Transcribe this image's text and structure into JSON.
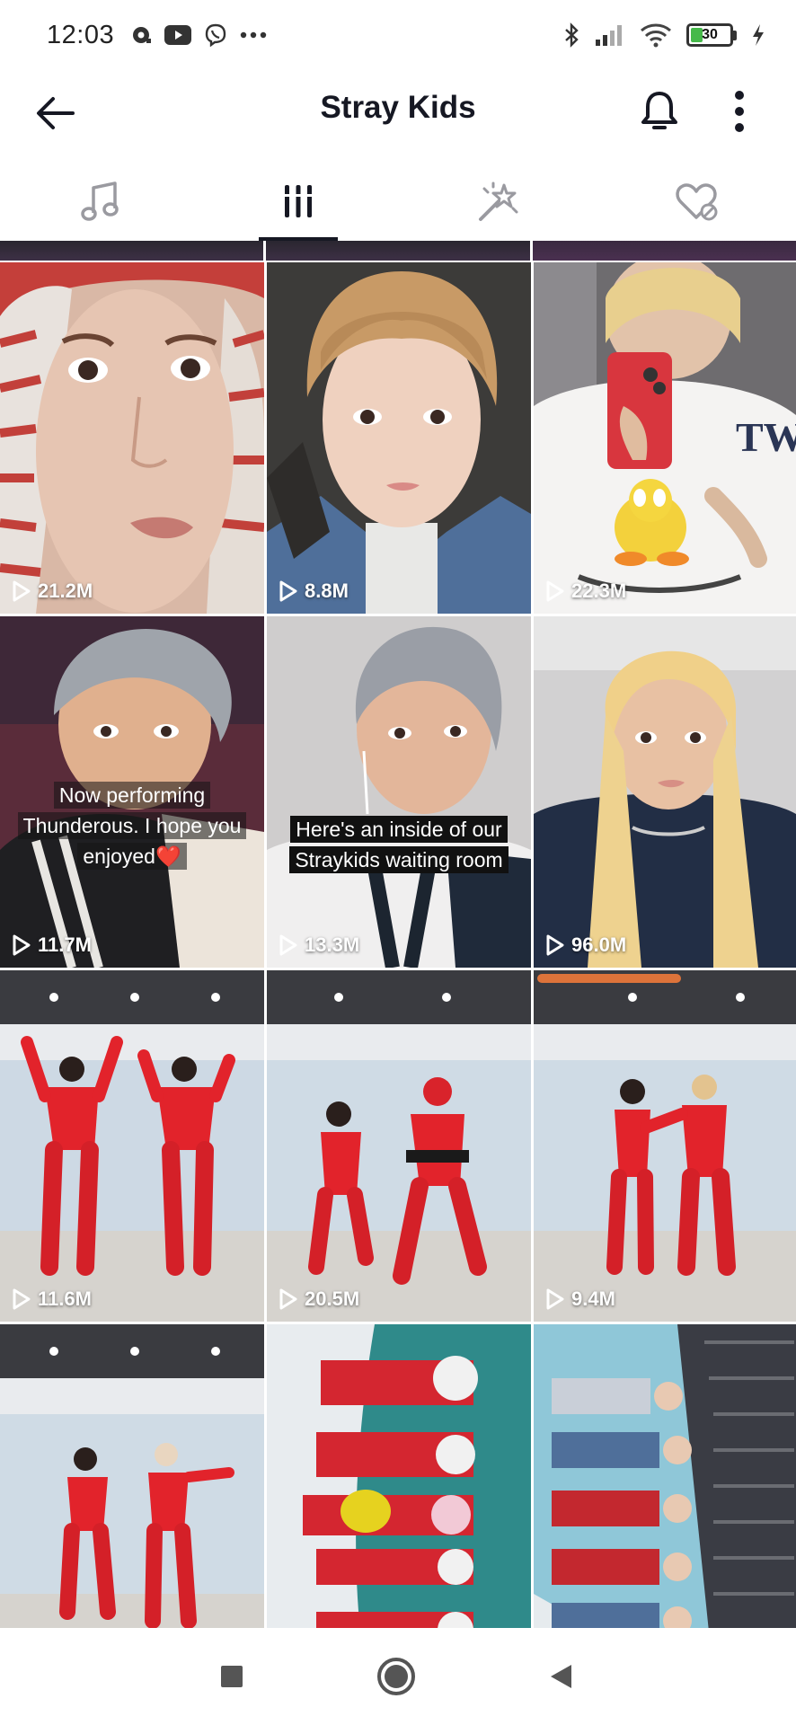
{
  "status_bar": {
    "time": "12:03",
    "left_icons": [
      "notification-icon",
      "youtube-icon",
      "viber-icon",
      "more-dots-icon"
    ],
    "right_icons": [
      "bluetooth-icon",
      "signal-icon",
      "wifi-icon",
      "battery-icon",
      "charging-icon"
    ],
    "battery_level": "30",
    "battery_fraction": 0.3
  },
  "header": {
    "title": "Stray Kids",
    "back_icon": "arrow-left-icon",
    "bell_icon": "bell-icon",
    "more_icon": "more-vertical-icon"
  },
  "tabs": [
    {
      "icon": "music-note-icon",
      "active": false
    },
    {
      "icon": "grid-icon",
      "active": true
    },
    {
      "icon": "magic-wand-icon",
      "active": false
    },
    {
      "icon": "heart-icon",
      "active": false
    }
  ],
  "videos": [
    {
      "views": "21.2M",
      "caption": ""
    },
    {
      "views": "8.8M",
      "caption": ""
    },
    {
      "views": "22.3M",
      "caption": ""
    },
    {
      "views": "11.7M",
      "caption": "Now performing Thunderous. I hope you enjoyed❤️"
    },
    {
      "views": "13.3M",
      "caption": "Here's an inside of our Straykids waiting room"
    },
    {
      "views": "96.0M",
      "caption": ""
    },
    {
      "views": "11.6M",
      "caption": ""
    },
    {
      "views": "20.5M",
      "caption": ""
    },
    {
      "views": "9.4M",
      "caption": ""
    },
    {
      "views": "",
      "caption": ""
    },
    {
      "views": "",
      "caption": ""
    },
    {
      "views": "",
      "caption": ""
    }
  ],
  "colors": {
    "text": "#161823",
    "accent_red": "#e2232b",
    "battery_green": "#46b94a"
  },
  "navbar": [
    "square-icon",
    "circle-icon",
    "triangle-back-icon"
  ]
}
